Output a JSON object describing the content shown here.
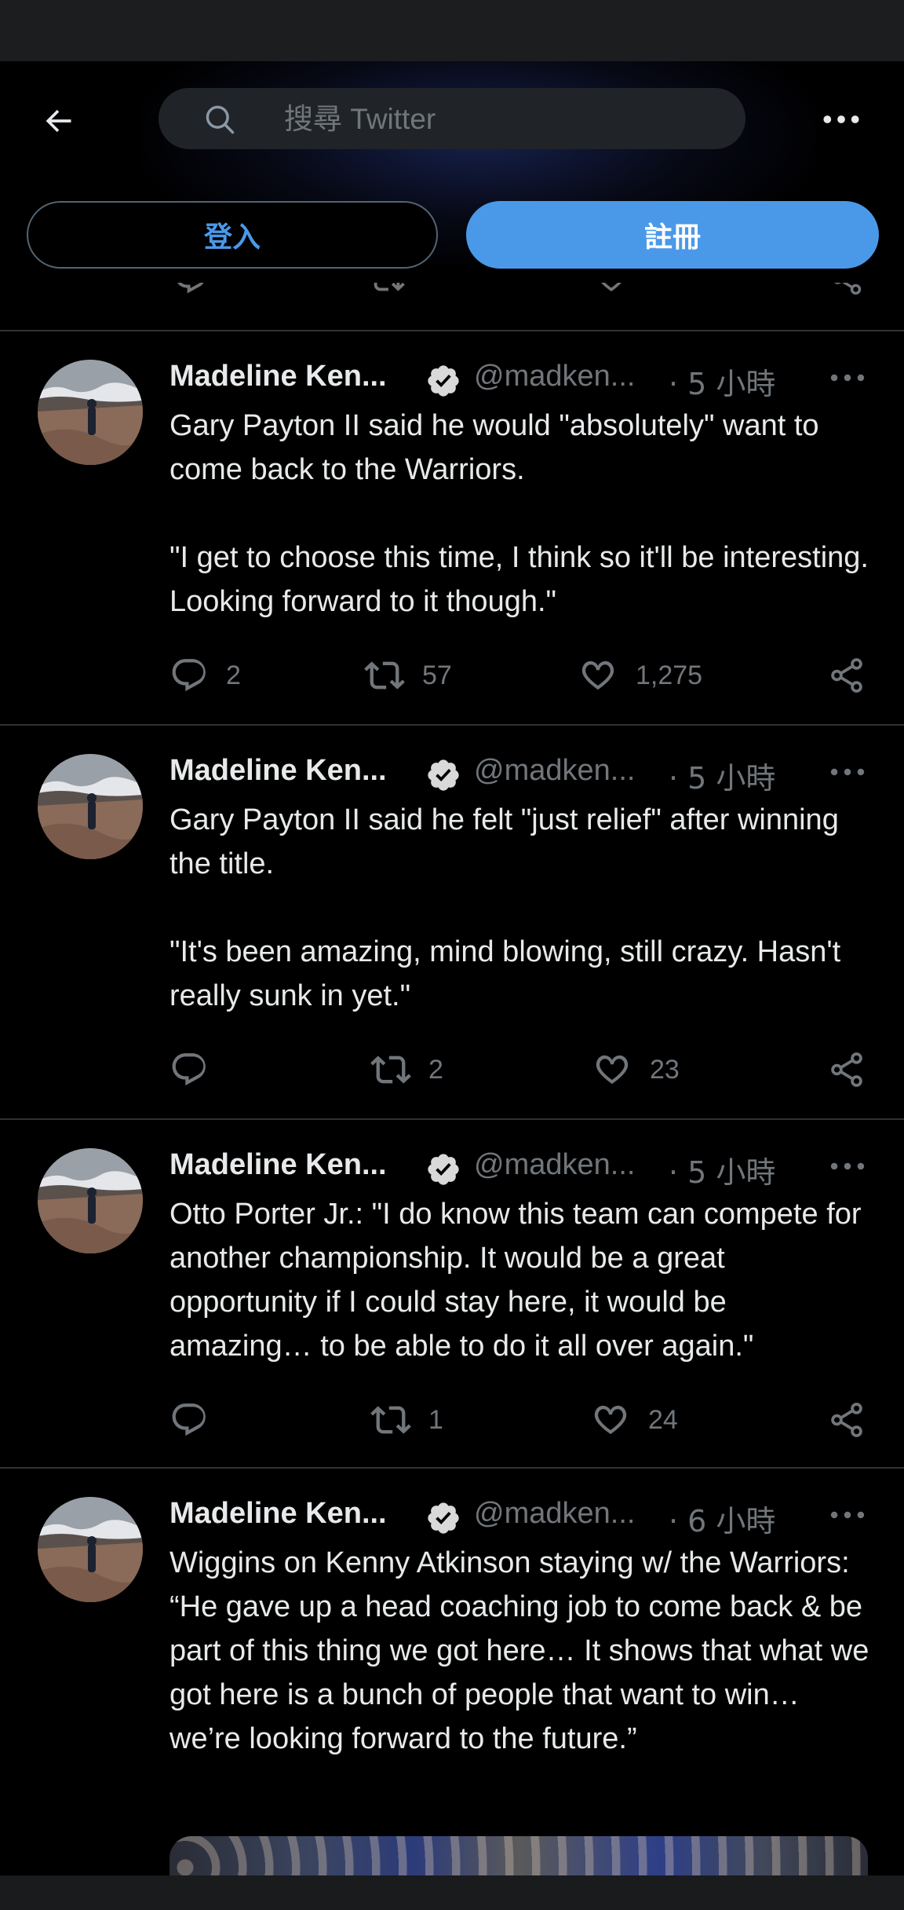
{
  "header": {
    "search_placeholder": "搜尋 Twitter",
    "login_label": "登入",
    "signup_label": "註冊"
  },
  "tweets": [
    {
      "name": "Madeline Ken...",
      "handle": "@madken...",
      "time": "· 5 小時",
      "text": "Gary Payton II said he would \"absolutely\" want to come back to the Warriors.\n\n\"I get to choose this time, I think so it'll be interesting. Looking forward to it though.\"",
      "replies": "2",
      "retweets": "57",
      "likes": "1,275"
    },
    {
      "name": "Madeline Ken...",
      "handle": "@madken...",
      "time": "· 5 小時",
      "text": "Gary Payton II said he felt \"just relief\" after winning the title.\n\n\"It's been amazing, mind blowing, still crazy. Hasn't really sunk in yet.\"",
      "replies": "",
      "retweets": "2",
      "likes": "23"
    },
    {
      "name": "Madeline Ken...",
      "handle": "@madken...",
      "time": "· 5 小時",
      "text": "Otto Porter Jr.: \"I do know this team can compete for another championship. It would be a great opportunity if I could stay here, it would be amazing… to be able to do it all over again.\"",
      "replies": "",
      "retweets": "1",
      "likes": "24"
    },
    {
      "name": "Madeline Ken...",
      "handle": "@madken...",
      "time": "· 6 小時",
      "text": "Wiggins on Kenny Atkinson staying w/ the Warriors: “He gave up a head coaching job to come back & be part of this thing we got here… It shows that what we got here is a bunch of people that want to win… we’re looking forward to the future.”"
    }
  ],
  "icons": {
    "back": "arrow-left-icon",
    "search": "search-icon",
    "more": "more-horizontal-icon",
    "verified": "verified-badge-icon",
    "reply": "reply-icon",
    "retweet": "retweet-icon",
    "like": "heart-icon",
    "share": "share-icon"
  },
  "colors": {
    "accent": "#4a99e9",
    "background": "#000000",
    "secondary_text": "#71767b",
    "divider": "#2f3336"
  }
}
